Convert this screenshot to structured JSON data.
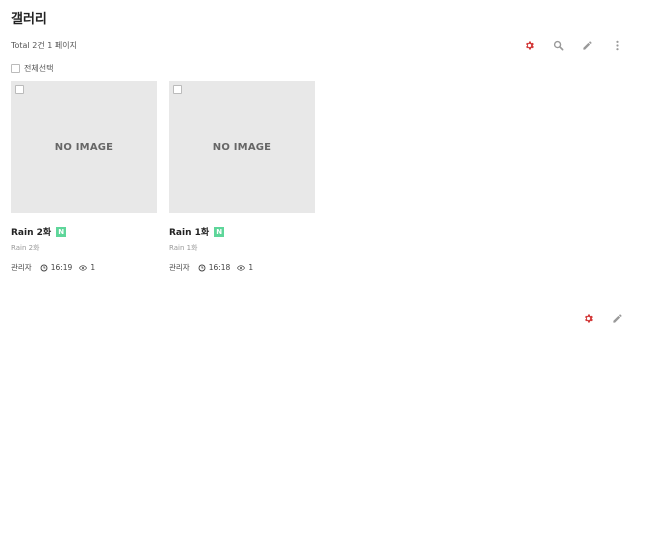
{
  "page": {
    "title": "갤러리",
    "total": "Total 2건 1 페이지"
  },
  "colors": {
    "gear": "#d33a3a",
    "badge": "#5ed69a",
    "icon_gray": "#999999"
  },
  "toolbar_icons": [
    "gear-icon",
    "search-icon",
    "pencil-icon",
    "more-vertical-icon"
  ],
  "bottom_icons": [
    "gear-icon",
    "pencil-icon"
  ],
  "select_all": {
    "label": "전체선택"
  },
  "posts": [
    {
      "no_image": "NO IMAGE",
      "title": "Rain 2화",
      "badge": "N",
      "subtitle": "Rain 2화",
      "author": "관리자",
      "time": "16:19",
      "views": "1"
    },
    {
      "no_image": "NO IMAGE",
      "title": "Rain 1화",
      "badge": "N",
      "subtitle": "Rain 1화",
      "author": "관리자",
      "time": "16:18",
      "views": "1"
    }
  ]
}
